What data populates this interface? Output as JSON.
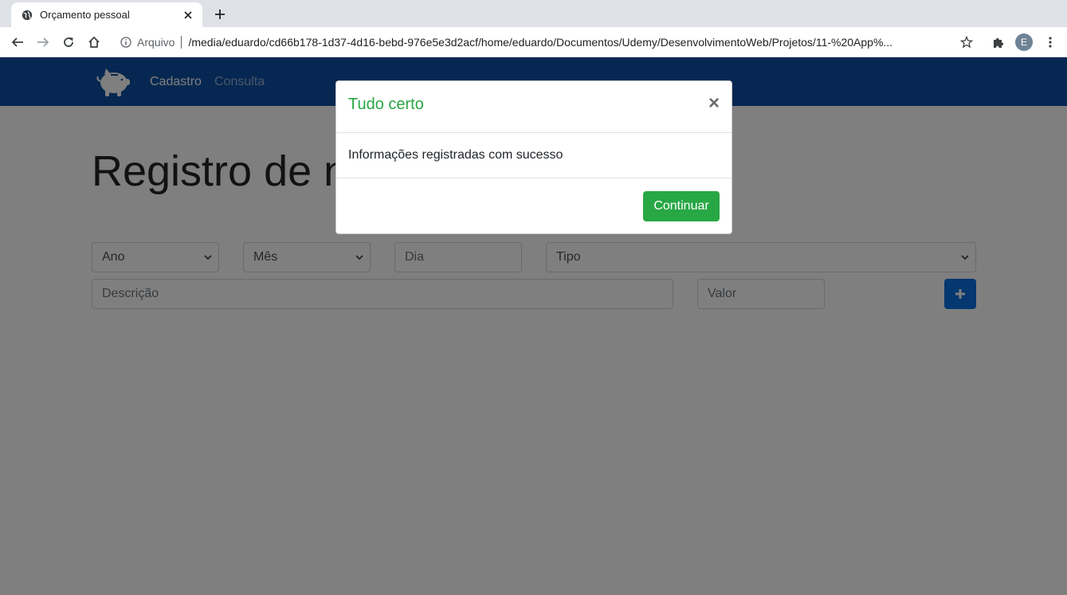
{
  "browser": {
    "tab_title": "Orçamento pessoal",
    "scheme_label": "Arquivo",
    "url": "/media/eduardo/cd66b178-1d37-4d16-bebd-976e5e3d2acf/home/eduardo/Documentos/Udemy/DesenvolvimentoWeb/Projetos/11-%20App%...",
    "profile_initial": "E"
  },
  "navbar": {
    "links": [
      {
        "label": "Cadastro",
        "active": true
      },
      {
        "label": "Consulta",
        "active": false
      }
    ]
  },
  "main": {
    "heading": "Registro de n",
    "selects": {
      "ano": "Ano",
      "mes": "Mês",
      "tipo": "Tipo"
    },
    "inputs": {
      "dia_placeholder": "Dia",
      "descricao_placeholder": "Descrição",
      "valor_placeholder": "Valor"
    }
  },
  "modal": {
    "title": "Tudo certo",
    "close_label": "×",
    "message": "Informações registradas com sucesso",
    "button_label": "Continuar"
  },
  "colors": {
    "navbar": "#0b4ea2",
    "success": "#28a745",
    "primary": "#0b6ee0"
  }
}
